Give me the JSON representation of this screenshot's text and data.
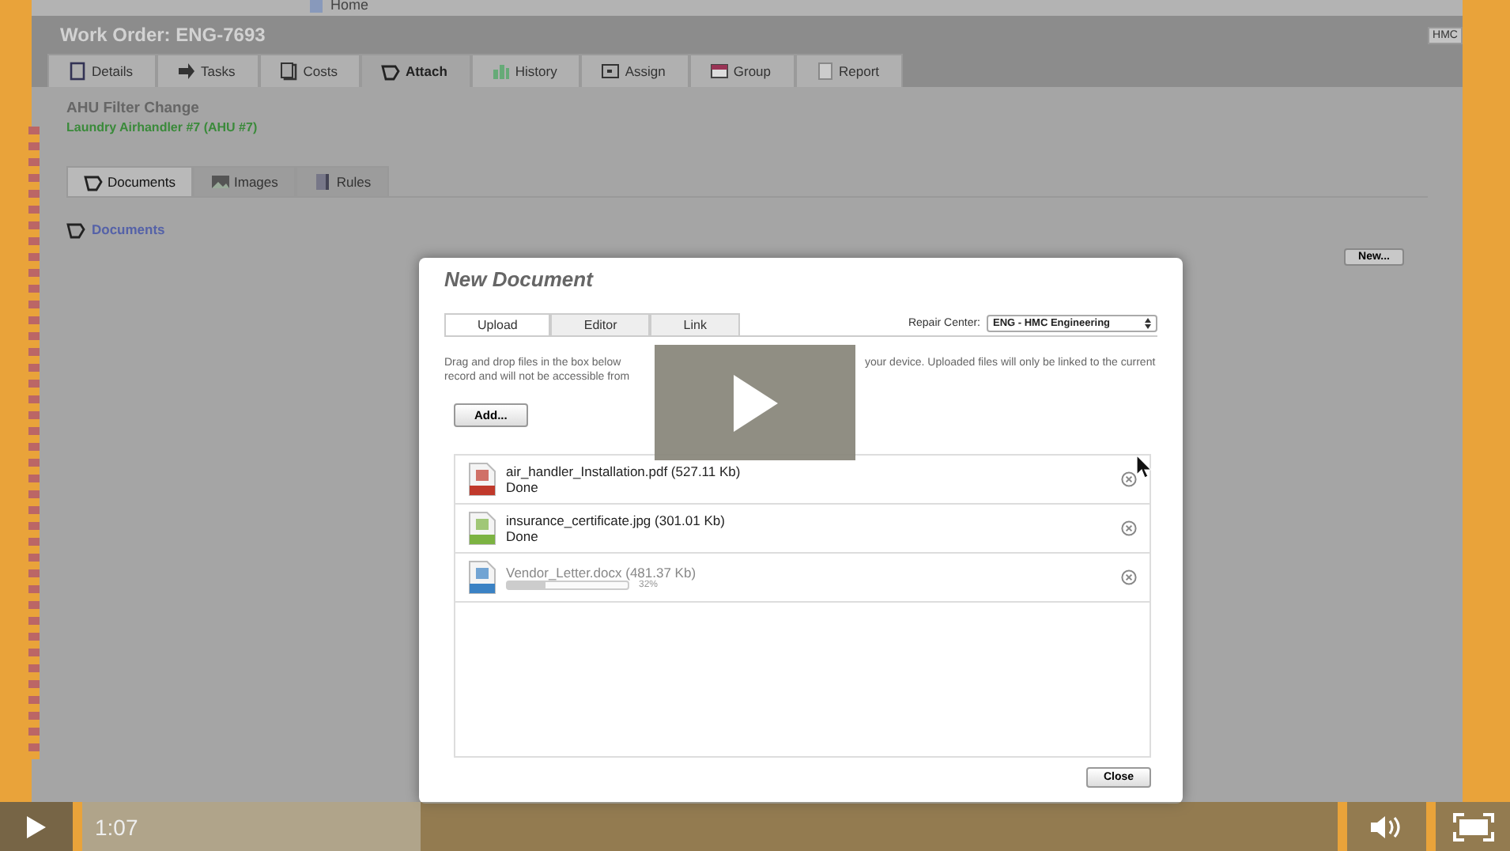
{
  "app": {
    "home_label": "Home",
    "title": "Work Order: ENG-7693",
    "user_badge": "HMC",
    "tabs": [
      {
        "label": "Details",
        "selected": false
      },
      {
        "label": "Tasks",
        "selected": false
      },
      {
        "label": "Costs",
        "selected": false
      },
      {
        "label": "Attach",
        "selected": true
      },
      {
        "label": "History",
        "selected": false
      },
      {
        "label": "Assign",
        "selected": false
      },
      {
        "label": "Group",
        "selected": false
      },
      {
        "label": "Report",
        "selected": false
      }
    ],
    "heading": "AHU Filter Change",
    "asset": "Laundry Airhandler #7 (AHU #7)",
    "subtabs": [
      {
        "label": "Documents",
        "selected": true
      },
      {
        "label": "Images",
        "selected": false
      },
      {
        "label": "Rules",
        "selected": false
      }
    ],
    "section_title": "Documents",
    "new_button": "New..."
  },
  "dialog": {
    "title": "New Document",
    "tabs": [
      {
        "label": "Upload",
        "selected": true
      },
      {
        "label": "Editor",
        "selected": false
      },
      {
        "label": "Link",
        "selected": false
      }
    ],
    "repair_center_label": "Repair Center:",
    "repair_center_value": "ENG - HMC Engineering",
    "instructions": [
      "Drag and drop files in the box below",
      "your device. Uploaded files will only be linked to the current",
      "record and will not be accessible from"
    ],
    "add_button": "Add...",
    "files": [
      {
        "kind": "pdf",
        "name": "air_handler_Installation.pdf (527.11 Kb)",
        "status": "Done"
      },
      {
        "kind": "jpg",
        "name": "insurance_certificate.jpg (301.01 Kb)",
        "status": "Done"
      },
      {
        "kind": "doc",
        "name": "Vendor_Letter.docx (481.37 Kb)",
        "level": 0.32,
        "reading": "32%"
      }
    ],
    "close_button": "Close"
  },
  "player": {
    "time": "1:07",
    "level": 0.27
  }
}
